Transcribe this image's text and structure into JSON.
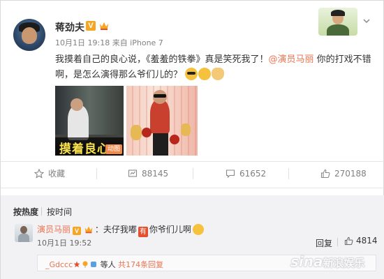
{
  "post": {
    "author": "蒋劲夫",
    "verified_mark": "V",
    "meta": "10月1日 19:18 来自 iPhone 7",
    "text_before": "我摸着自己的良心说，《羞羞的铁拳》真是笑死我了！",
    "mention": "@演员马丽",
    "text_after": " 你的打戏不错啊，是怎么演得那么爷们儿的？",
    "image1_caption": "摸着良心",
    "image1_badge": "动图"
  },
  "actions": {
    "favorite": "收藏",
    "repost_count": "88145",
    "comment_count": "61652",
    "like_count": "270188"
  },
  "comments": {
    "sort_hot": "按热度",
    "sort_time": "按时间",
    "items": [
      {
        "name": "演员马丽",
        "verified_mark": "V",
        "text_before": "：夫仔我嘟",
        "you_badge": "有",
        "text_after": "你爷们儿啊",
        "date": "10月1日 19:52",
        "reply_label": "回复",
        "like_count": "4814",
        "sub": {
          "name": "_Gdccc",
          "text": " 等人 ",
          "count_text": "共174条回复"
        }
      }
    ]
  },
  "watermark": {
    "brand": "sina",
    "text": "新浪娱乐"
  },
  "colors": {
    "mention": "#eb7350",
    "verified": "#f5a623",
    "muted": "#808080"
  }
}
